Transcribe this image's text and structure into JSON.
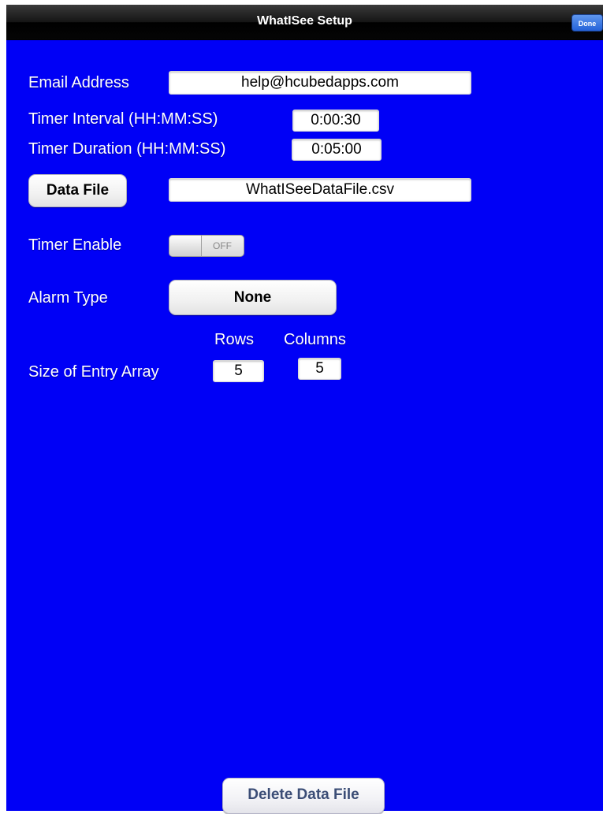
{
  "navbar": {
    "title": "WhatISee Setup",
    "done_label": "Done"
  },
  "form": {
    "email_label": "Email Address",
    "email_value": "help@hcubedapps.com",
    "timer_interval_label": "Timer Interval (HH:MM:SS)",
    "timer_interval_value": "0:00:30",
    "timer_duration_label": "Timer Duration (HH:MM:SS)",
    "timer_duration_value": "0:05:00",
    "data_file_button_label": "Data File",
    "data_file_value": "WhatISeeDataFile.csv",
    "timer_enable_label": "Timer Enable",
    "timer_enable_state": "OFF",
    "alarm_type_label": "Alarm Type",
    "alarm_type_value": "None",
    "rows_header": "Rows",
    "columns_header": "Columns",
    "entry_array_label": "Size of Entry Array",
    "rows_value": "5",
    "columns_value": "5"
  },
  "footer": {
    "delete_button_label": "Delete Data File"
  },
  "colors": {
    "background": "#0000f6",
    "navbar": "#000000",
    "done_button": "#2f6fe0"
  }
}
